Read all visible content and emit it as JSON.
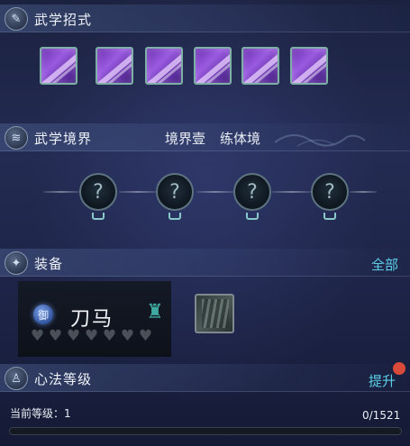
{
  "sections": {
    "moves": {
      "title": "武学招式",
      "icon": "sword-icon"
    },
    "realm": {
      "title": "武学境界",
      "realm_label": "境界壹",
      "realm_value": "练体境",
      "icon": "swirl-icon"
    },
    "equip": {
      "title": "装备",
      "all_label": "全部",
      "icon": "shield-emblem-icon"
    },
    "heart_method": {
      "title": "心法等级",
      "upgrade_label": "提升",
      "icon": "monk-icon"
    }
  },
  "skills": [
    {
      "name": "skill-1"
    },
    {
      "name": "skill-2"
    },
    {
      "name": "skill-3"
    },
    {
      "name": "skill-4"
    },
    {
      "name": "skill-5"
    },
    {
      "name": "skill-6"
    }
  ],
  "realm_nodes": [
    {
      "symbol": "?"
    },
    {
      "symbol": "?"
    },
    {
      "symbol": "?"
    },
    {
      "symbol": "?"
    }
  ],
  "equipment": {
    "badge": "御",
    "name": "刀马",
    "hearts_total": 7,
    "hearts_filled": 0
  },
  "level": {
    "current_label": "当前等级：1",
    "progress_text": "0/1521",
    "progress_current": 0,
    "progress_max": 1521
  },
  "colors": {
    "accent_link": "#5bd0e8",
    "progress_fill": "#6ad0e0",
    "notification_dot": "#d84a3a"
  }
}
